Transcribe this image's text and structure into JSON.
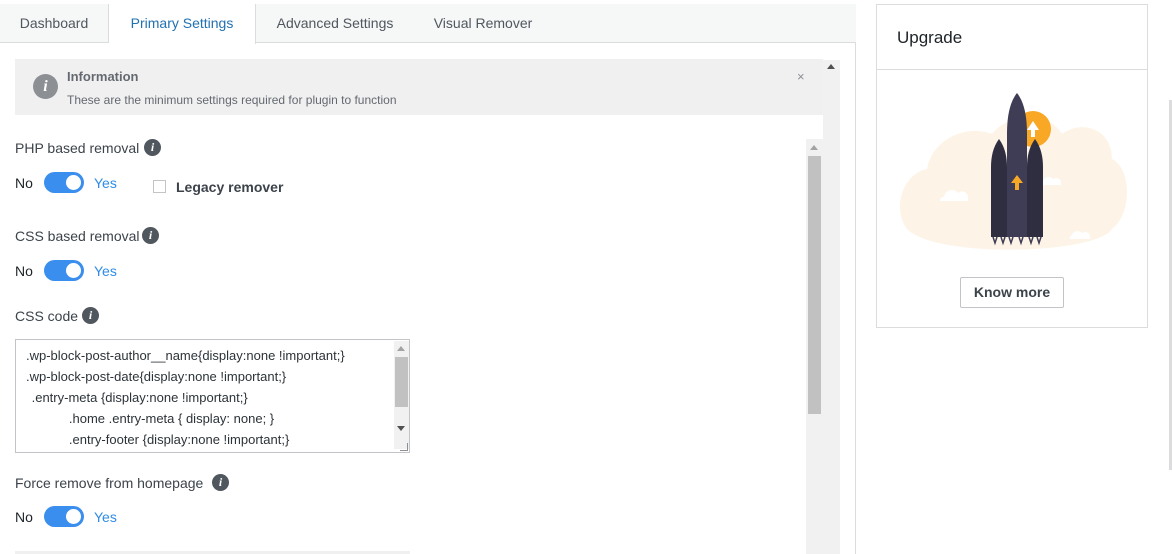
{
  "tabs": [
    {
      "label": "Dashboard",
      "active": false
    },
    {
      "label": "Primary Settings",
      "active": true
    },
    {
      "label": "Advanced Settings",
      "active": false
    },
    {
      "label": "Visual Remover",
      "active": false
    }
  ],
  "info": {
    "title": "Information",
    "text": "These are the minimum settings required for plugin to function",
    "close": "×",
    "icon": "i"
  },
  "fields": {
    "php_removal": {
      "label": "PHP based removal",
      "no": "No",
      "yes": "Yes",
      "on": true
    },
    "legacy": {
      "label": "Legacy remover",
      "checked": false
    },
    "css_removal": {
      "label": "CSS based removal",
      "no": "No",
      "yes": "Yes",
      "on": true
    },
    "css_code": {
      "label": "CSS code",
      "lines": [
        ".wp-block-post-author__name{display:none !important;}",
        ".wp-block-post-date{display:none !important;}",
        " .entry-meta {display:none !important;}",
        "\t.home .entry-meta { display: none; }",
        "\t.entry-footer {display:none !important;}"
      ]
    },
    "force_home": {
      "label": "Force remove from homepage",
      "no": "No",
      "yes": "Yes",
      "on": true
    }
  },
  "help_glyph": "i",
  "upgrade": {
    "title": "Upgrade",
    "button": "Know more"
  },
  "colors": {
    "toggle_on": "#3a8eed",
    "active_tab": "#2271b1",
    "rocket_body": "#3f3d56",
    "accent": "#f9a825"
  }
}
